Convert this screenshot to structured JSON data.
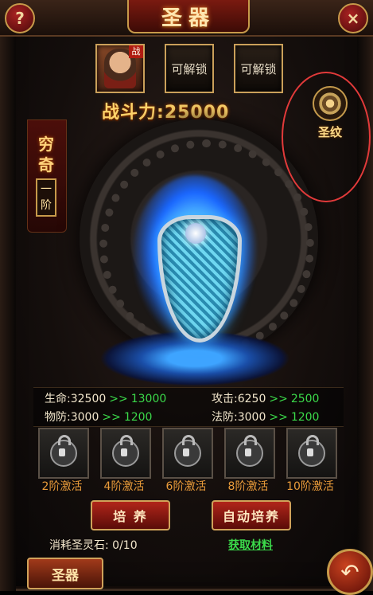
{
  "header": {
    "title": "圣器",
    "help_label": "?",
    "close_label": "×"
  },
  "slots": [
    {
      "type": "hero",
      "badge": "战"
    },
    {
      "type": "locked",
      "label": "可解锁"
    },
    {
      "type": "locked",
      "label": "可解锁"
    }
  ],
  "power": {
    "label": "战斗力:",
    "value": "25000"
  },
  "rank": {
    "name_line1": "穷",
    "name_line2": "奇",
    "tier": "一阶"
  },
  "pattern": {
    "label": "圣纹"
  },
  "stats": {
    "hp": {
      "label": "生命:",
      "current": "32500",
      "arrow": ">>",
      "next": "13000"
    },
    "atk": {
      "label": "攻击:",
      "current": "6250",
      "arrow": ">>",
      "next": "2500"
    },
    "pdef": {
      "label": "物防:",
      "current": "3000",
      "arrow": ">>",
      "next": "1200"
    },
    "mdef": {
      "label": "法防:",
      "current": "3000",
      "arrow": ">>",
      "next": "1200"
    }
  },
  "locks": [
    {
      "label": "2阶激活"
    },
    {
      "label": "4阶激活"
    },
    {
      "label": "6阶激活"
    },
    {
      "label": "8阶激活"
    },
    {
      "label": "10阶激活"
    }
  ],
  "actions": {
    "train": "培 养",
    "auto_train": "自动培养"
  },
  "consume": {
    "label": "消耗圣灵石:",
    "value": "0/10"
  },
  "get_material": "获取材料",
  "bottom_tab": "圣器",
  "colors": {
    "accent_gold": "#caa05a",
    "stat_up_green": "#3bd94a",
    "lock_label_orange": "#e99b3a",
    "highlight_red": "#e23a3a"
  }
}
